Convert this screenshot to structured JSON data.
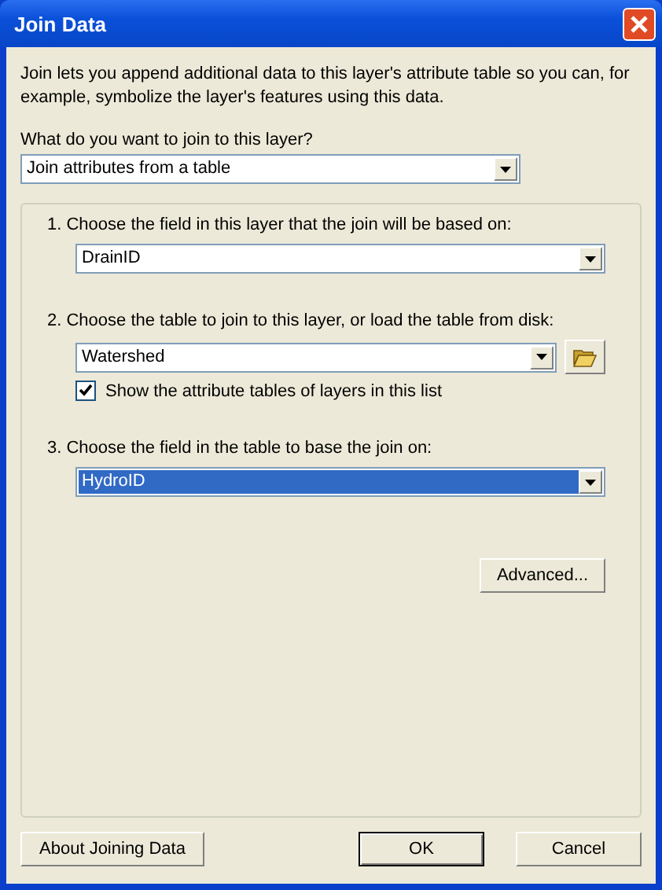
{
  "window": {
    "title": "Join Data"
  },
  "intro": "Join lets you append additional data to this layer's attribute table so you can, for example, symbolize the layer's features using this data.",
  "join_type": {
    "label": "What do you want to join to this layer?",
    "value": "Join attributes from a table"
  },
  "steps": [
    {
      "label": "1.  Choose the field in this layer that the join will be based on:",
      "value": "DrainID",
      "focused": false,
      "kind": "combo"
    },
    {
      "label": "2.  Choose the table to join to this layer, or load the table from disk:",
      "value": "Watershed",
      "focused": false,
      "kind": "combo-browse",
      "checkbox": {
        "label": "Show the attribute tables of layers in this list",
        "checked": true
      }
    },
    {
      "label": "3.  Choose the field in the table to base the join on:",
      "value": "HydroID",
      "focused": true,
      "kind": "combo"
    }
  ],
  "advanced_button": "Advanced...",
  "buttons": [
    {
      "label": "About Joining Data",
      "default": false
    },
    {
      "label": "OK",
      "default": true
    },
    {
      "label": "Cancel",
      "default": false
    }
  ]
}
